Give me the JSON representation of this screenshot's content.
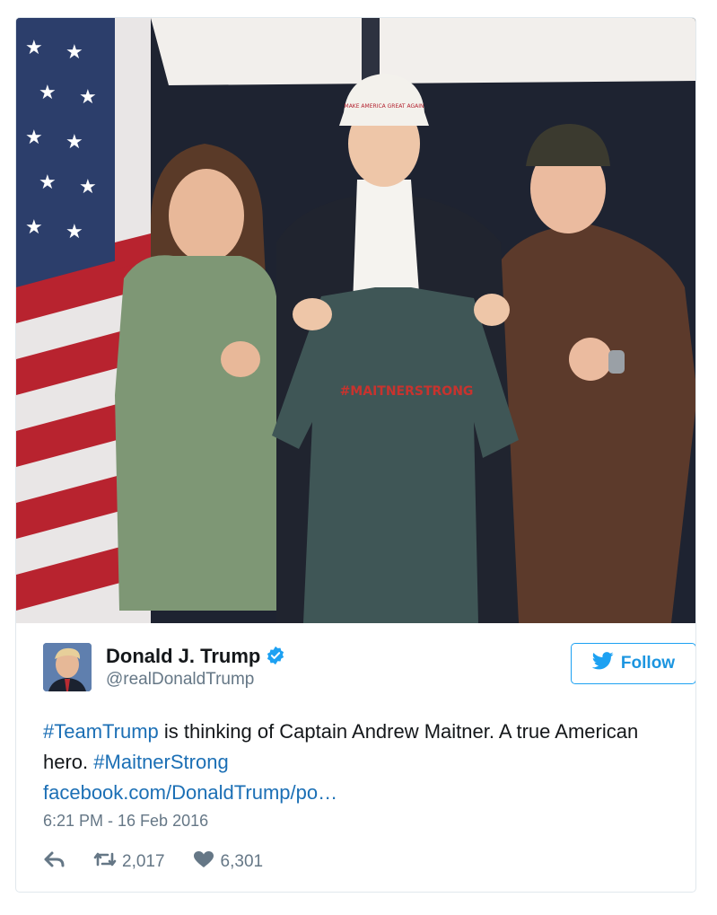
{
  "tweet": {
    "author": {
      "display_name": "Donald J. Trump",
      "handle": "@realDonaldTrump",
      "verified": true,
      "avatar": "avatar-photo"
    },
    "follow_label": "Follow",
    "text": {
      "hashtag_1": "#TeamTrump",
      "body_1": " is thinking of Captain Andrew Maitner. A true American hero. ",
      "hashtag_2": "#MaitnerStrong",
      "link": "facebook.com/DonaldTrump/po…"
    },
    "timestamp": "6:21 PM - 16 Feb 2016",
    "actions": {
      "reply_icon": "reply-icon",
      "retweet_icon": "retweet-icon",
      "retweet_count": "2,017",
      "like_icon": "heart-icon",
      "like_count": "6,301"
    },
    "photo": {
      "shirt_text": "#MAITNERSTRONG",
      "hat_text": "MAKE AMERICA GREAT AGAIN"
    }
  },
  "colors": {
    "link": "#1b6fb5",
    "twitter_blue": "#1da1f2",
    "muted": "#657786",
    "name": "#14171a"
  }
}
